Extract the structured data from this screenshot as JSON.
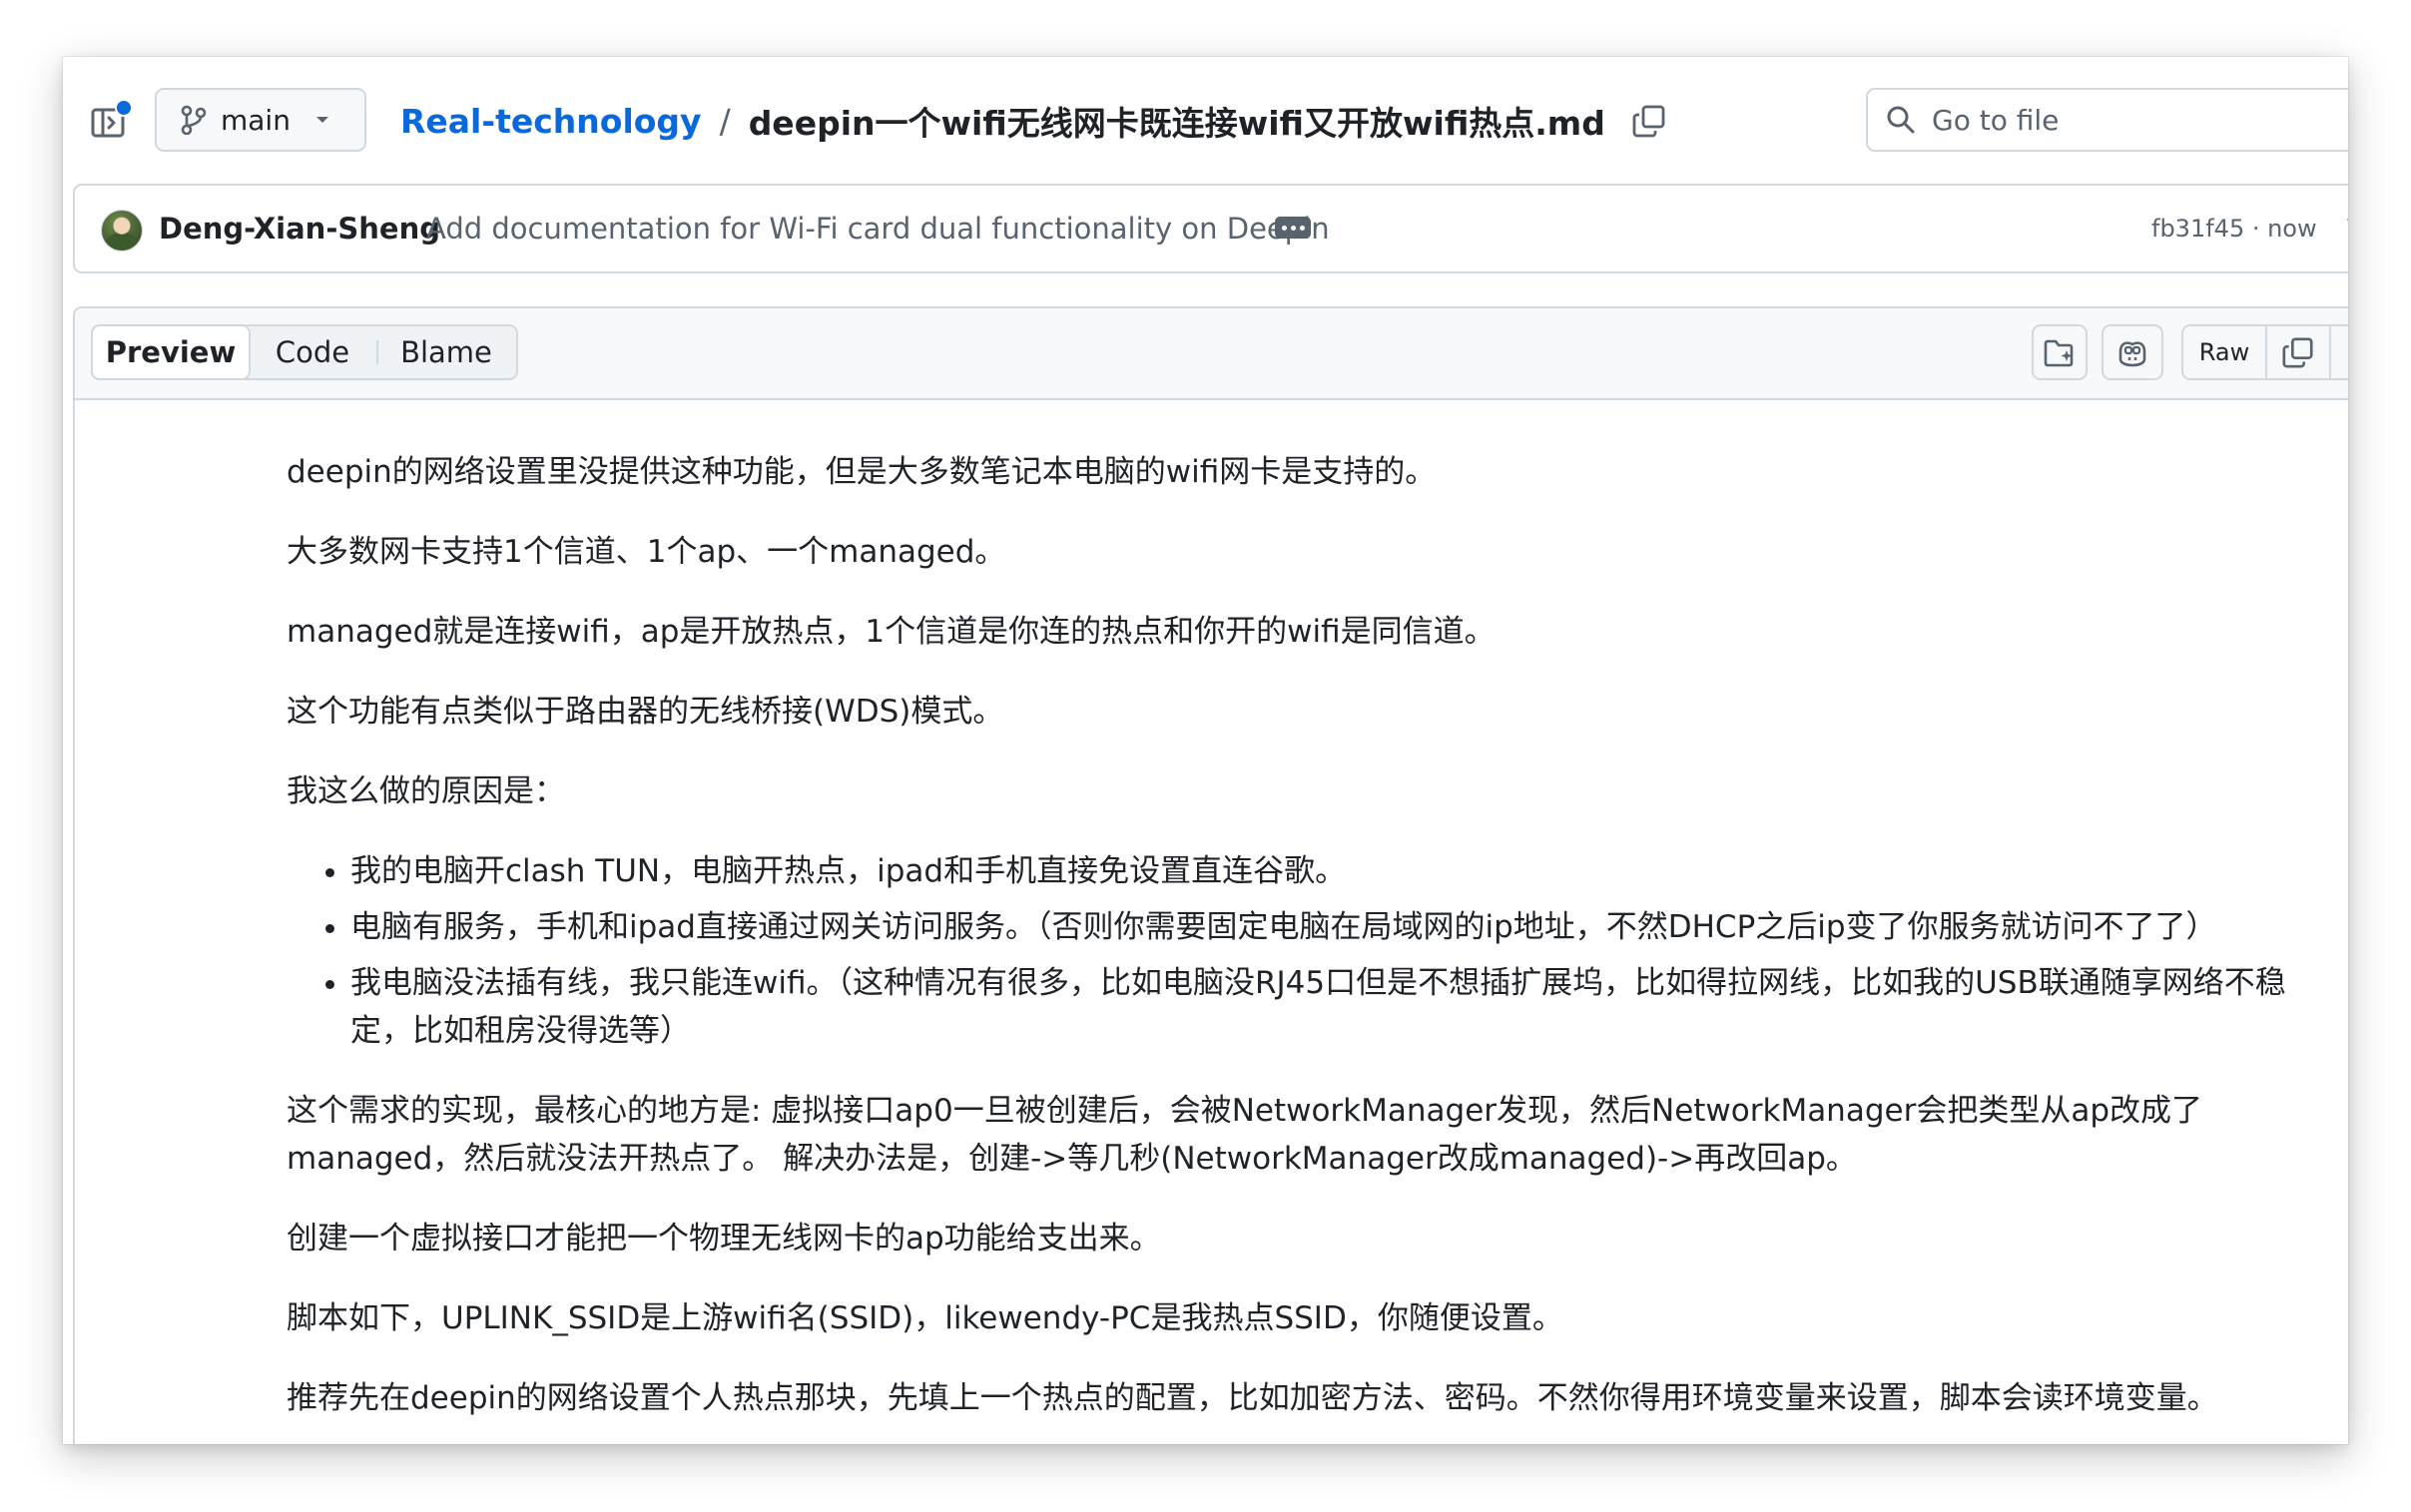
{
  "header": {
    "branch_label": "main",
    "repo_name": "Real-technology",
    "path_separator": "/",
    "file_name": "deepin一个wifi无线网卡既连接wifi又开放wifi热点.md",
    "goto_placeholder": "Go to file"
  },
  "commit": {
    "author": "Deng-Xian-Sheng",
    "message": "Add documentation for Wi-Fi card dual functionality on Deepin",
    "sha_time": "fb31f45 · now"
  },
  "file_tabs": {
    "preview": "Preview",
    "code": "Code",
    "blame": "Blame",
    "raw": "Raw"
  },
  "content": {
    "p1": "deepin的网络设置里没提供这种功能，但是大多数笔记本电脑的wifi网卡是支持的。",
    "p2": "大多数网卡支持1个信道、1个ap、一个managed。",
    "p3": "managed就是连接wifi，ap是开放热点，1个信道是你连的热点和你开的wifi是同信道。",
    "p4": "这个功能有点类似于路由器的无线桥接(WDS)模式。",
    "p5": "我这么做的原因是：",
    "reasons": [
      "我的电脑开clash TUN，电脑开热点，ipad和手机直接免设置直连谷歌。",
      "电脑有服务，手机和ipad直接通过网关访问服务。（否则你需要固定电脑在局域网的ip地址，不然DHCP之后ip变了你服务就访问不了了）",
      "我电脑没法插有线，我只能连wifi。（这种情况有很多，比如电脑没RJ45口但是不想插扩展坞，比如得拉网线，比如我的USB联通随享网络不稳定，比如租房没得选等）"
    ],
    "p6": "这个需求的实现，最核心的地方是: 虚拟接口ap0一旦被创建后，会被NetworkManager发现，然后NetworkManager会把类型从ap改成了managed，然后就没法开热点了。 解决办法是，创建->等几秒(NetworkManager改成managed)->再改回ap。",
    "p7": "创建一个虚拟接口才能把一个物理无线网卡的ap功能给支出来。",
    "p8": "脚本如下，UPLINK_SSID是上游wifi名(SSID)，likewendy-PC是我热点SSID，你随便设置。",
    "p9": "推荐先在deepin的网络设置个人热点那块，先填上一个热点的配置，比如加密方法、密码。不然你得用环境变量来设置，脚本会读环境变量。"
  },
  "colors": {
    "link": "#0969da",
    "text": "#1f2328",
    "muted": "#59636e",
    "border": "#d1d9e0",
    "subtle_bg": "#f6f8fa"
  },
  "icons": {
    "sidebar": "sidebar-expand-icon",
    "branch": "git-branch-icon",
    "caret": "triangle-down-icon",
    "copy": "copy-icon",
    "search": "search-icon",
    "ellipsis": "kebab-horizontal-icon",
    "history": "history-icon",
    "symbols": "file-symbols-icon",
    "copilot": "copilot-icon",
    "download": "download-icon"
  }
}
